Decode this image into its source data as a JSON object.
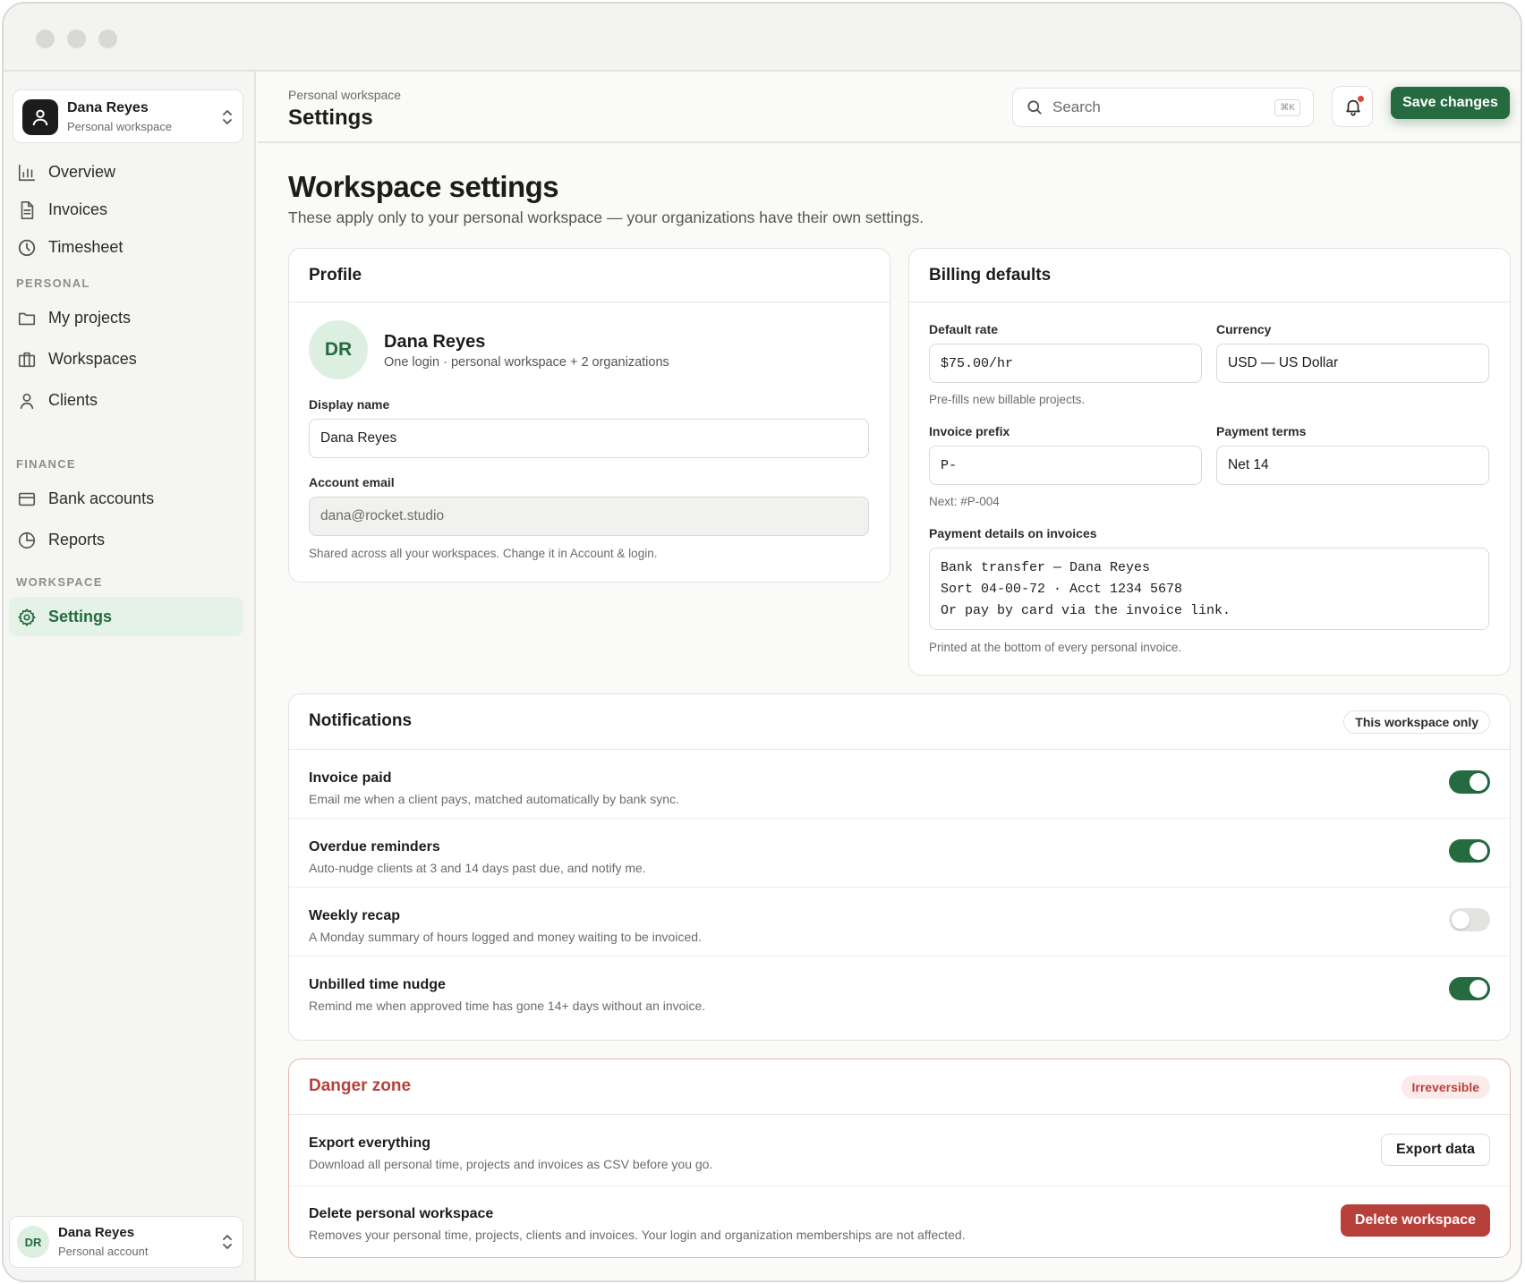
{
  "sidebar": {
    "workspace_name": "Dana Reyes",
    "workspace_sub": "Personal workspace",
    "items": [
      {
        "label": "Overview"
      },
      {
        "label": "Invoices"
      },
      {
        "label": "Timesheet"
      }
    ],
    "sections": {
      "personal": "PERSONAL",
      "finance": "FINANCE",
      "workspace": "WORKSPACE"
    },
    "personal_items": [
      {
        "label": "My projects"
      },
      {
        "label": "Workspaces"
      },
      {
        "label": "Clients"
      }
    ],
    "finance_items": [
      {
        "label": "Bank accounts"
      },
      {
        "label": "Reports"
      }
    ],
    "workspace_items": [
      {
        "label": "Settings",
        "active": true
      }
    ],
    "account": {
      "initials": "DR",
      "name": "Dana Reyes",
      "sub": "Personal account"
    }
  },
  "header": {
    "breadcrumb": "Personal workspace",
    "title": "Settings",
    "search_placeholder": "Search",
    "search_shortcut": "⌘K",
    "save_label": "Save changes"
  },
  "main": {
    "title": "Workspace settings",
    "subtitle": "These apply only to your personal workspace — your organizations have their own settings."
  },
  "profile": {
    "title": "Profile",
    "initials": "DR",
    "name": "Dana Reyes",
    "sub": "One login · personal workspace + 2 organizations",
    "display_name_label": "Display name",
    "display_name_value": "Dana Reyes",
    "email_label": "Account email",
    "email_value": "dana@rocket.studio",
    "email_hint": "Shared across all your workspaces. Change it in Account & login."
  },
  "billing": {
    "title": "Billing defaults",
    "rate_label": "Default rate",
    "rate_value": "$75.00/hr",
    "rate_hint": "Pre-fills new billable projects.",
    "currency_label": "Currency",
    "currency_value": "USD — US Dollar",
    "prefix_label": "Invoice prefix",
    "prefix_value": "P-",
    "prefix_hint": "Next: #P-004",
    "terms_label": "Payment terms",
    "terms_value": "Net 14",
    "payment_label": "Payment details on invoices",
    "payment_value": "Bank transfer — Dana Reyes\nSort 04-00-72 · Acct 1234 5678\nOr pay by card via the invoice link.",
    "payment_hint": "Printed at the bottom of every personal invoice."
  },
  "notifications": {
    "title": "Notifications",
    "scope": "This workspace only",
    "items": [
      {
        "title": "Invoice paid",
        "desc": "Email me when a client pays, matched automatically by bank sync.",
        "on": true
      },
      {
        "title": "Overdue reminders",
        "desc": "Auto-nudge clients at 3 and 14 days past due, and notify me.",
        "on": true
      },
      {
        "title": "Weekly recap",
        "desc": "A Monday summary of hours logged and money waiting to be invoiced.",
        "on": false
      },
      {
        "title": "Unbilled time nudge",
        "desc": "Remind me when approved time has gone 14+ days without an invoice.",
        "on": true
      }
    ]
  },
  "danger": {
    "title": "Danger zone",
    "badge": "Irreversible",
    "export_title": "Export everything",
    "export_desc": "Download all personal time, projects and invoices as CSV before you go.",
    "export_button": "Export data",
    "delete_title": "Delete personal workspace",
    "delete_desc": "Removes your personal time, projects, clients and invoices. Your login and organization memberships are not affected.",
    "delete_button": "Delete workspace"
  },
  "colors": {
    "accent": "#256b3f",
    "accent_soft": "#e4f2e7",
    "danger": "#b8403b"
  }
}
